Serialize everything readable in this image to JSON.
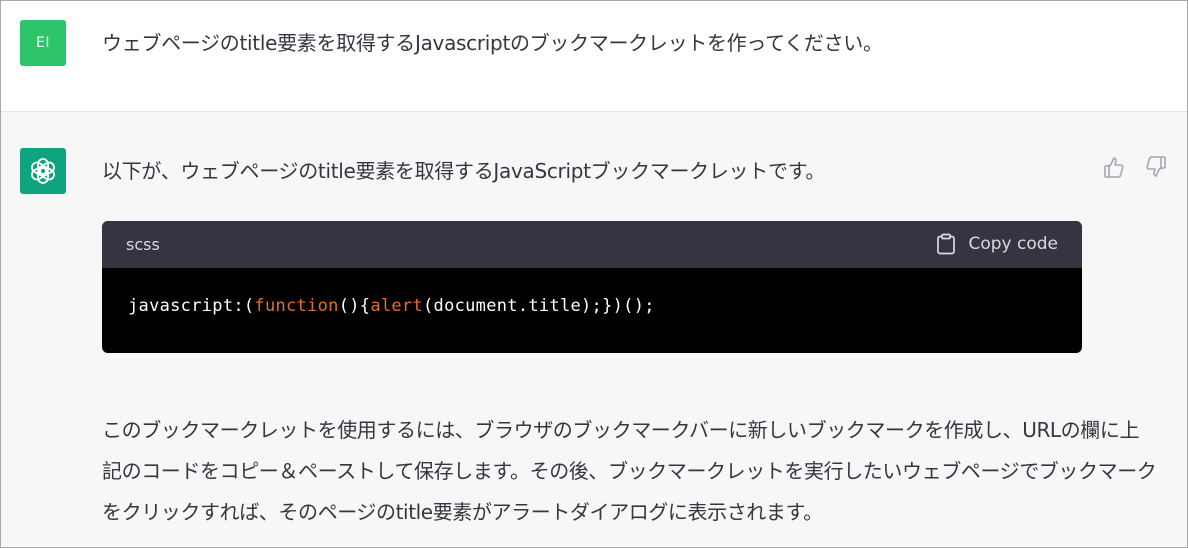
{
  "user": {
    "avatar_initials": "EI",
    "avatar_color": "#2dc46a",
    "message": "ウェブページのtitle要素を取得するJavascriptのブックマークレットを作ってください。"
  },
  "assistant": {
    "avatar_icon": "openai-logo-icon",
    "avatar_color": "#10a37f",
    "intro": "以下が、ウェブページのtitle要素を取得するJavaScriptブックマークレットです。",
    "feedback": {
      "like_icon": "thumbs-up-icon",
      "dislike_icon": "thumbs-down-icon"
    },
    "code_block": {
      "language": "scss",
      "copy_label": "Copy code",
      "copy_icon": "clipboard-icon",
      "code_prefix": "javascript:(",
      "code_kw1": "function",
      "code_mid": "(){",
      "code_kw2": "alert",
      "code_suffix": "(document.title);})();",
      "keyword_color": "#df6f2a"
    },
    "answer_lines": [
      "このブックマークレットを使用するには、ブラウザのブックマークバーに新しいブックマークを作成し、URLの欄に上",
      "記のコードをコピー＆ペーストして保存します。その後、ブックマークレットを実行したいウェブページでブックマーク",
      "をクリックすれば、そのページのtitle要素がアラートダイアログに表示されます。"
    ]
  }
}
